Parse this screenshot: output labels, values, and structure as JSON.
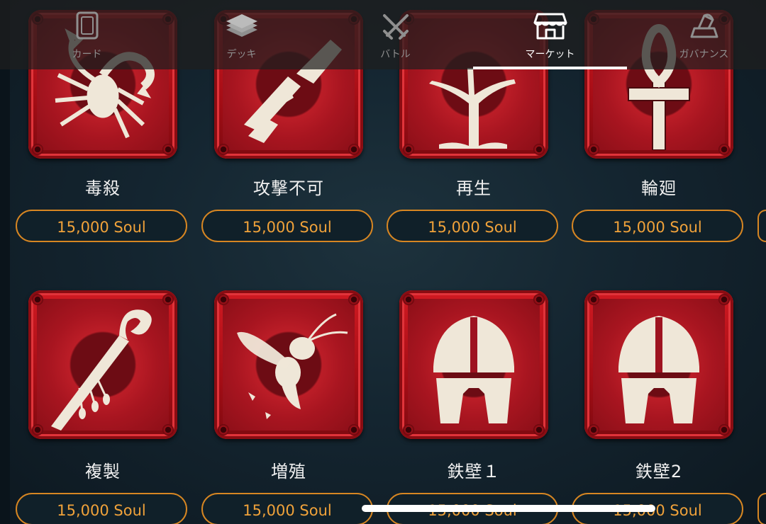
{
  "nav": {
    "tabs": [
      {
        "label": "カード",
        "icon": "card-icon",
        "active": false
      },
      {
        "label": "デッキ",
        "icon": "deck-icon",
        "active": false
      },
      {
        "label": "バトル",
        "icon": "crossed-swords-icon",
        "active": false
      },
      {
        "label": "マーケット",
        "icon": "store-icon",
        "active": true
      },
      {
        "label": "ガバナンス",
        "icon": "vote-icon",
        "active": false
      }
    ]
  },
  "items": [
    {
      "name": "毒殺",
      "price": "15,000 Soul",
      "icon": "scorpion-icon"
    },
    {
      "name": "攻撃不可",
      "price": "15,000 Soul",
      "icon": "broken-sword-icon"
    },
    {
      "name": "再生",
      "price": "15,000 Soul",
      "icon": "tree-icon"
    },
    {
      "name": "輪廻",
      "price": "15,000 Soul",
      "icon": "ankh-icon"
    },
    {
      "name": "複製",
      "price": "15,000 Soul",
      "icon": "staff-icon"
    },
    {
      "name": "増殖",
      "price": "15,000 Soul",
      "icon": "wasp-icon"
    },
    {
      "name": "鉄壁１",
      "price": "15,000 Soul",
      "icon": "helmet-icon"
    },
    {
      "name": "鉄壁2",
      "price": "15,000 Soul",
      "icon": "helmet-icon"
    }
  ],
  "colors": {
    "accent": "#d78622",
    "price_text": "#f0a23a",
    "tile_red": "#c3151e"
  }
}
